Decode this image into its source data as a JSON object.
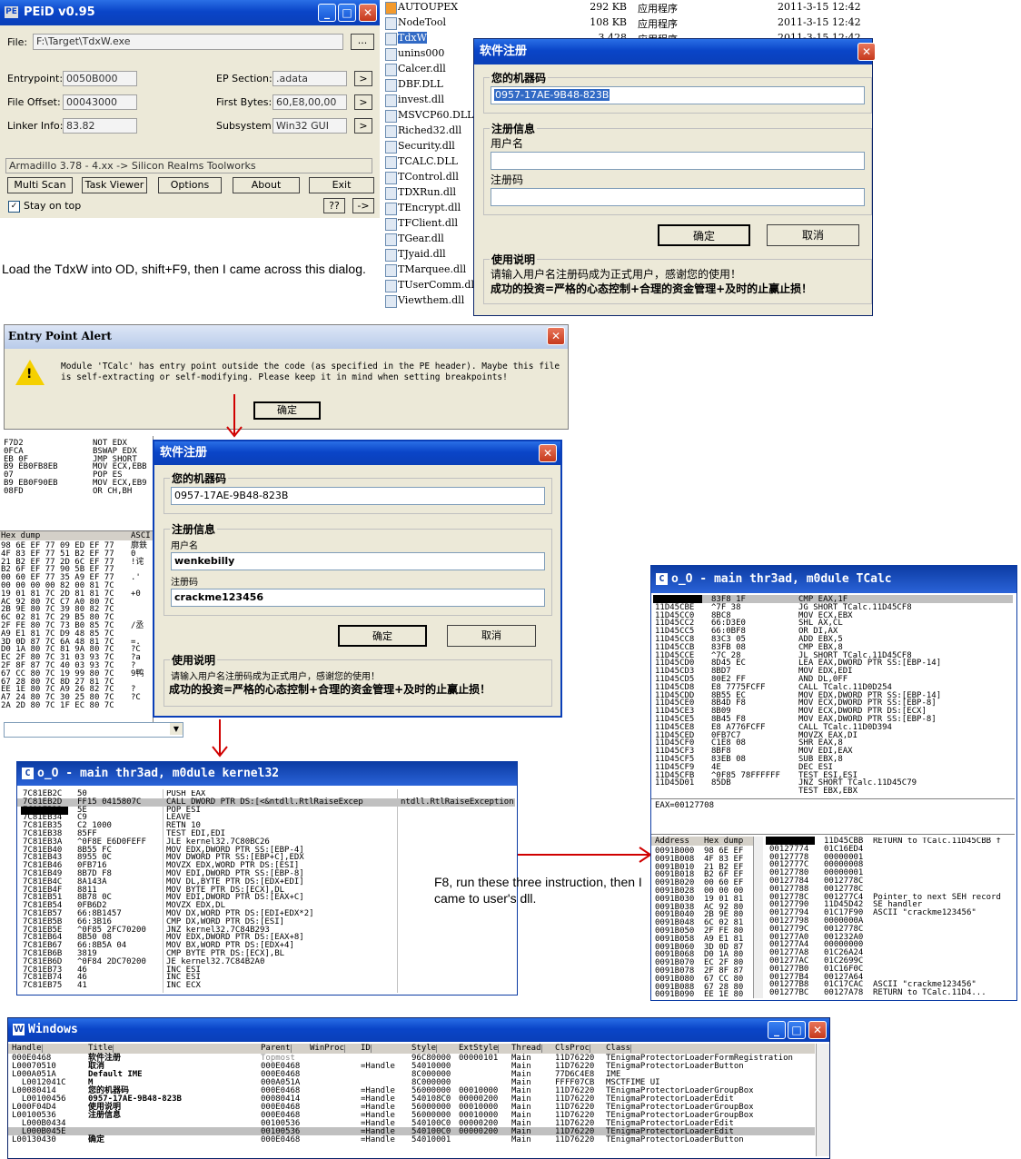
{
  "peid": {
    "title": "PEiD v0.95",
    "file_label": "File:",
    "file_value": "F:\\Target\\TdxW.exe",
    "browse": "...",
    "entrypoint_label": "Entrypoint:",
    "entrypoint_value": "0050B000",
    "ep_section_label": "EP Section:",
    "ep_section_value": ".adata",
    "file_offset_label": "File Offset:",
    "file_offset_value": "00043000",
    "first_bytes_label": "First Bytes:",
    "first_bytes_value": "60,E8,00,00",
    "linker_label": "Linker Info:",
    "linker_value": "83.82",
    "subsystem_label": "Subsystem:",
    "subsystem_value": "Win32 GUI",
    "arrow": ">",
    "detection": "Armadillo 3.78 - 4.xx -> Silicon Realms Toolworks",
    "multi_scan": "Multi Scan",
    "task_viewer": "Task Viewer",
    "options": "Options",
    "about": "About",
    "exit": "Exit",
    "stay_on_top": "Stay on top",
    "qq": "??",
    "go": "->"
  },
  "note1": "Load the TdxW into OD, shift+F9, then I came across this dialog.",
  "files": [
    {
      "name": "AUTOUPEX",
      "size": "292 KB",
      "type": "应用程序",
      "date": "2011-3-15 12:42"
    },
    {
      "name": "NodeTool",
      "size": "108 KB",
      "type": "应用程序",
      "date": "2011-3-15 12:42"
    },
    {
      "name": "TdxW",
      "size": "3,428 KB",
      "type": "应用程序",
      "date": "2011-3-15 12:42"
    },
    {
      "name": "unins000",
      "size": "",
      "type": "",
      "date": ""
    },
    {
      "name": "Calcer.dll",
      "size": "",
      "type": "",
      "date": ""
    },
    {
      "name": "DBF.DLL",
      "size": "",
      "type": "",
      "date": ""
    },
    {
      "name": "invest.dll",
      "size": "",
      "type": "",
      "date": ""
    },
    {
      "name": "MSVCP60.DLL",
      "size": "",
      "type": "",
      "date": ""
    },
    {
      "name": "Riched32.dll",
      "size": "",
      "type": "",
      "date": ""
    },
    {
      "name": "Security.dll",
      "size": "",
      "type": "",
      "date": ""
    },
    {
      "name": "TCALC.DLL",
      "size": "",
      "type": "",
      "date": ""
    },
    {
      "name": "TControl.dll",
      "size": "",
      "type": "",
      "date": ""
    },
    {
      "name": "TDXRun.dll",
      "size": "",
      "type": "",
      "date": ""
    },
    {
      "name": "TEncrypt.dll",
      "size": "",
      "type": "",
      "date": ""
    },
    {
      "name": "TFClient.dll",
      "size": "",
      "type": "",
      "date": ""
    },
    {
      "name": "TGear.dll",
      "size": "",
      "type": "",
      "date": ""
    },
    {
      "name": "TJyaid.dll",
      "size": "",
      "type": "",
      "date": ""
    },
    {
      "name": "TMarquee.dll",
      "size": "",
      "type": "",
      "date": ""
    },
    {
      "name": "TUserComm.dll",
      "size": "",
      "type": "",
      "date": ""
    },
    {
      "name": "Viewthem.dll",
      "size": "",
      "type": "",
      "date": ""
    }
  ],
  "reg1": {
    "title": "软件注册",
    "machine_label": "您的机器码",
    "machine_value": "0957-17AE-9B48-823B",
    "reg_info": "注册信息",
    "user_label": "用户名",
    "code_label": "注册码",
    "ok": "确定",
    "cancel": "取消",
    "usage_label": "使用说明",
    "usage_text": "请输入用户名注册码成为正式用户，感谢您的使用！",
    "slogan": "成功的投资=严格的心态控制+合理的资金管理+及时的止赢止损！"
  },
  "alert": {
    "title": "Entry Point Alert",
    "message": "Module 'TCalc' has entry point outside the code (as specified in the PE header). Maybe this file is self-extracting or self-modifying. Please keep it in mind when setting breakpoints!",
    "ok": "确定"
  },
  "reg2": {
    "title": "软件注册",
    "machine_label": "您的机器码",
    "machine_value": "0957-17AE-9B48-823B",
    "reg_info": "注册信息",
    "user_label": "用户名",
    "user_value": "wenkebilly",
    "code_label": "注册码",
    "code_value": "crackme123456",
    "ok": "确定",
    "cancel": "取消",
    "usage_label": "使用说明",
    "usage_text": "请输入用户名注册码成为正式用户，感谢您的使用！",
    "slogan": "成功的投资=严格的心态控制+合理的资金管理+及时的止赢止损！"
  },
  "od_left": {
    "code": "F7D2\n0FCA\nEB 0F\nB9 EB0FB8EB\n07\nB9 EB0F90EB\n08FD",
    "asm": "NOT EDX\nBSWAP EDX\nJMP SHORT\nMOV ECX,EBB\nPOP ES\nMOV ECX,EB9\nOR CH,BH",
    "hex_header": "Hex dump",
    "ascii_header": "ASCI",
    "hex": "98 6E EF 77 09 ED EF 77\n4F 83 EF 77 51 B2 EF 77\n21 B2 EF 77 2D 6C EF 77\nB2 6F EF 77 90 5B EF 77\n00 60 EF 77 35 A9 EF 77\n00 00 00 00 82 00 81 7C\n19 01 81 7C 2D 81 81 7C\nAC 92 80 7C C7 A0 80 7C\n2B 9E 80 7C 39 80 82 7C\n6C 02 81 7C 29 B5 80 7C\n2F FE 80 7C 73 B0 85 7C\nA9 E1 81 7C D9 48 85 7C\n3D 0D 87 7C 6A 48 81 7C\nD0 1A 80 7C 81 9A 80 7C\nEC 2F 80 7C 31 03 93 7C\n2F 8F 87 7C 40 03 93 7C\n67 CC 80 7C 19 99 80 7C\n67 28 80 7C 8D 27 81 7C\nEE 1E 80 7C A9 26 82 7C\nA7 24 80 7C 30 25 80 7C\n2A 2D 80 7C 1F EC 80 7C",
    "ascii": "廓鉄\n0\n!诧\n\n.'\n\n+0\n\n\n\n/丞\n\n=.\n?C\n?a\n?\n9鸭\n\n?\n?C\n"
  },
  "od_kernel": {
    "title": "o_O - main thr3ad, m0dule kernel32",
    "icon": "C",
    "addr": "7C81EB2C\n7C81EB2D\n7C81EB33\n7C81EB34\n7C81EB35\n7C81EB38\n7C81EB3A\n7C81EB40\n7C81EB43\n7C81EB46\n7C81EB49\n7C81EB4C\n7C81EB4F\n7C81EB51\n7C81EB54\n7C81EB57\n7C81EB5B\n7C81EB5E\n7C81EB64\n7C81EB67\n7C81EB6B\n7C81EB6D\n7C81EB73\n7C81EB74\n7C81EB75",
    "hex": "50\nFF15 0415807C\n5E\nC9\nC2 1000\n85FF\n^0F8E E6D0FEFF\n8B55 FC\n8955 0C\n0FB716\n8B7D F8\n8A143A\n8811\n8B78 0C\n0FB6D2\n66:8B1457\n66:3B16\n^0F85 2FC70200\n8B50 08\n66:8B5A 04\n3819\n^0F84 2DC70200\n46\n46\n41",
    "asm": "PUSH EAX\nCALL DWORD PTR DS:[<&ntdll.RtlRaiseExcep\nPOP ESI\nLEAVE\nRETN 10\nTEST EDI,EDI\nJLE kernel32.7C80BC26\nMOV EDX,DWORD PTR SS:[EBP-4]\nMOV DWORD PTR SS:[EBP+C],EDX\nMOVZX EDX,WORD PTR DS:[ESI]\nMOV EDI,DWORD PTR SS:[EBP-8]\nMOV DL,BYTE PTR DS:[EDX+EDI]\nMOV BYTE PTR DS:[ECX],DL\nMOV EDI,DWORD PTR DS:[EAX+C]\nMOVZX EDX,DL\nMOV DX,WORD PTR DS:[EDI+EDX*2]\nCMP DX,WORD PTR DS:[ESI]\nJNZ kernel32.7C84B293\nMOV EDX,DWORD PTR DS:[EAX+8]\nMOV BX,WORD PTR DS:[EDX+4]\nCMP BYTE PTR DS:[ECX],BL\nJE kernel32.7C84B2A0\nINC ESI\nINC ESI\nINC ECX",
    "comment": "ntdll.RtlRaiseException"
  },
  "note2": "F8, run these three instruction, then I came to user's dll.",
  "od_tcalc": {
    "title": "o_O - main thr3ad, m0dule TCalc",
    "icon": "C",
    "addr": "11D45CBB\n11D45CBE\n11D45CC0\n11D45CC2\n11D45CC5\n11D45CC8\n11D45CCB\n11D45CCE\n11D45CD0\n11D45CD3\n11D45CD5\n11D45CD8\n11D45CDD\n11D45CE0\n11D45CE3\n11D45CE5\n11D45CE8\n11D45CED\n11D45CF0\n11D45CF3\n11D45CF5\n11D45CF9\n11D45CFB\n11D45D01",
    "hex": "83F8 1F\n^7F 38\n8BC8\n66:D3E0\n66:0BF8\n83C3 05\n83FB 08\n^7C 28\n8D45 EC\n8BD7\n80E2 FF\nE8 7775FCFF\n8B55 EC\n8B4D F8\n8B09\n8B45 F8\nE8 A776FCFF\n0FB7C7\nC1E8 08\n8BF8\n83EB 08\n4E\n^0F85 78FFFFFF\n85DB",
    "asm": "CMP EAX,1F\nJG SHORT TCalc.11D45CF8\nMOV ECX,EBX\nSHL AX,CL\nOR DI,AX\nADD EBX,5\nCMP EBX,8\nJL SHORT TCalc.11D45CF8\nLEA EAX,DWORD PTR SS:[EBP-14]\nMOV EDX,EDI\nAND DL,0FF\nCALL TCalc.11D0D254\nMOV EDX,DWORD PTR SS:[EBP-14]\nMOV ECX,DWORD PTR SS:[EBP-8]\nMOV ECX,DWORD PTR DS:[ECX]\nMOV EAX,DWORD PTR SS:[EBP-8]\nCALL TCalc.11D0D394\nMOVZX EAX,DI\nSHR EAX,8\nMOV EDI,EAX\nSUB EBX,8\nDEC ESI\nTEST ESI,ESI\nJNZ SHORT TCalc.11D45C79\nTEST EBX,EBX",
    "eax": "EAX=00127708",
    "dump_addr_header": "Address",
    "dump_hex_header": "Hex dump",
    "dump_addr": "0091B000\n0091B008\n0091B010\n0091B018\n0091B020\n0091B028\n0091B030\n0091B038\n0091B040\n0091B048\n0091B050\n0091B058\n0091B060\n0091B068\n0091B070\n0091B078\n0091B080\n0091B088\n0091B090",
    "dump_hex": "98 6E EF\n4F 83 EF\n21 B2 EF\nB2 6F EF\n00 60 EF\n00 00 00\n19 01 81\nAC 92 80\n2B 9E 80\n6C 02 81\n2F FE 80\nA9 E1 81\n3D 0D 87\nD0 1A 80\nEC 2F 80\n2F 8F 87\n67 CC 80\n67 28 80\nEE 1E 80",
    "stack_addr": "00127770\n00127774\n00127778\n0012777C\n00127780\n00127784\n00127788\n0012778C\n00127790\n00127794\n00127798\n0012779C\n001277A0\n001277A4\n001277A8\n001277AC\n001277B0\n001277B4\n001277B8\n001277BC",
    "stack_val": "11D45CBB\n01C16ED4\n00000001\n00000008\n00000001\n0012778C\n0012778C\n001277C4\n11D45D42\n01C17F90\n0000000A\n0012778C\n001232A0\n00000000\n01C26A24\n01C2699C\n01C16F0C\n00127A64\n01C17CAC\n00127A78",
    "stack_comment": "RETURN to TCalc.11D45CBB f\n\n\n\n\n\n\nPointer to next SEH record\nSE handler\nASCII \"crackme123456\"\n\n\n\n\n\n\n\n\nASCII \"crackme123456\"\nRETURN to TCalc.11D4..."
  },
  "windows": {
    "title": "Windows",
    "icon": "W",
    "headers": [
      "Handle",
      "Title",
      "Parent",
      "WinProc",
      "ID",
      "Style",
      "ExtStyle",
      "Thread",
      "ClsProc",
      "Class"
    ],
    "rows": [
      [
        "000E0468",
        "软件注册",
        "Topmost",
        "",
        "",
        "96C80000",
        "00000101",
        "Main",
        "11D76220",
        "TEnigmaProtectorLoaderFormRegistration"
      ],
      [
        "L00070510",
        "取消",
        "000E0468",
        "",
        "=Handle",
        "54010000",
        "",
        "Main",
        "11D76220",
        "TEnigmaProtectorLoaderButton"
      ],
      [
        "L000A051A",
        "Default IME",
        "000E0468",
        "",
        "",
        "8C000000",
        "",
        "Main",
        "77D6C4E8",
        "IME"
      ],
      [
        "  L0012041C",
        "M",
        "000A051A",
        "",
        "",
        "8C000000",
        "",
        "Main",
        "FFFF07CB",
        "MSCTFIME UI"
      ],
      [
        "L00080414",
        "您的机器码",
        "000E0468",
        "",
        "=Handle",
        "56000000",
        "00010000",
        "Main",
        "11D76220",
        "TEnigmaProtectorLoaderGroupBox"
      ],
      [
        "  L00100456",
        "0957-17AE-9B48-823B",
        "00080414",
        "",
        "=Handle",
        "540108C0",
        "00000200",
        "Main",
        "11D76220",
        "TEnigmaProtectorLoaderEdit"
      ],
      [
        "L000F04D4",
        "使用说明",
        "000E0468",
        "",
        "=Handle",
        "56000000",
        "00010000",
        "Main",
        "11D76220",
        "TEnigmaProtectorLoaderGroupBox"
      ],
      [
        "L00100536",
        "注册信息",
        "000E0468",
        "",
        "=Handle",
        "56000000",
        "00010000",
        "Main",
        "11D76220",
        "TEnigmaProtectorLoaderGroupBox"
      ],
      [
        "  L000B0434",
        "",
        "00100536",
        "",
        "=Handle",
        "540100C0",
        "00000200",
        "Main",
        "11D76220",
        "TEnigmaProtectorLoaderEdit"
      ],
      [
        "  L000B045E",
        "",
        "00100536",
        "",
        "=Handle",
        "540100C0",
        "00000200",
        "Main",
        "11D76220",
        "TEnigmaProtectorLoaderEdit"
      ],
      [
        "L00130430",
        "确定",
        "000E0468",
        "",
        "=Handle",
        "54010001",
        "",
        "Main",
        "11D76220",
        "TEnigmaProtectorLoaderButton"
      ]
    ]
  },
  "colors": {
    "xp_blue": "#0a45c8",
    "olly_title": "#0c3ca4",
    "arrow_red": "#d00000",
    "selection": "#0a246a"
  }
}
